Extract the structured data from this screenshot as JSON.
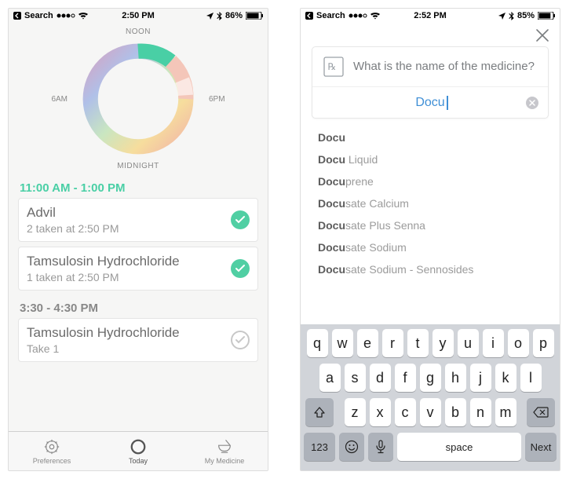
{
  "phone_a": {
    "status": {
      "back": "Search",
      "time": "2:50 PM",
      "battery": "86%"
    },
    "clock_labels": {
      "top": "NOON",
      "bottom": "MIDNIGHT",
      "left": "6AM",
      "right": "6PM"
    },
    "slots": [
      {
        "range": "11:00 AM - 1:00 PM",
        "active": true,
        "cards": [
          {
            "name": "Advil",
            "sub": "2 taken at 2:50 PM",
            "status": "done"
          },
          {
            "name": "Tamsulosin Hydrochloride",
            "sub": "1 taken at 2:50 PM",
            "status": "done"
          }
        ]
      },
      {
        "range": "3:30 - 4:30 PM",
        "active": false,
        "cards": [
          {
            "name": "Tamsulosin Hydrochloride",
            "sub": "Take 1",
            "status": "pending"
          }
        ]
      }
    ],
    "tabs": [
      {
        "label": "Preferences",
        "icon": "gear"
      },
      {
        "label": "Today",
        "icon": "circle",
        "active": true
      },
      {
        "label": "My Medicine",
        "icon": "mortar"
      }
    ]
  },
  "phone_b": {
    "status": {
      "back": "Search",
      "time": "2:52 PM",
      "battery": "85%"
    },
    "prompt": "What is the name of the medicine?",
    "input_value": "Docu",
    "suggestions": [
      {
        "match": "Docu",
        "rest": ""
      },
      {
        "match": "Docu",
        "rest": " Liquid"
      },
      {
        "match": "Docu",
        "rest": "prene"
      },
      {
        "match": "Docu",
        "rest": "sate Calcium"
      },
      {
        "match": "Docu",
        "rest": "sate Plus Senna"
      },
      {
        "match": "Docu",
        "rest": "sate Sodium"
      },
      {
        "match": "Docu",
        "rest": "sate Sodium - Sennosides"
      }
    ],
    "keyboard": {
      "row1": [
        "q",
        "w",
        "e",
        "r",
        "t",
        "y",
        "u",
        "i",
        "o",
        "p"
      ],
      "row2": [
        "a",
        "s",
        "d",
        "f",
        "g",
        "h",
        "j",
        "k",
        "l"
      ],
      "row3": [
        "z",
        "x",
        "c",
        "v",
        "b",
        "n",
        "m"
      ],
      "num": "123",
      "space": "space",
      "next": "Next"
    }
  }
}
